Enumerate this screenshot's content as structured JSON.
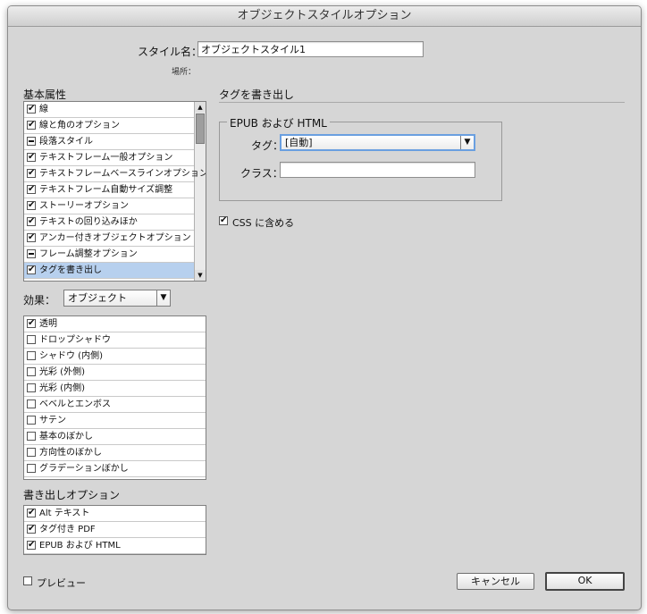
{
  "dialog": {
    "title": "オブジェクトスタイルオプション"
  },
  "header": {
    "style_name_label": "スタイル名：",
    "style_name_value": "オブジェクトスタイル1",
    "location_label": "場所："
  },
  "basic_attributes": {
    "title": "基本属性",
    "items": [
      {
        "label": "線",
        "state": "checked"
      },
      {
        "label": "線と角のオプション",
        "state": "checked"
      },
      {
        "label": "段落スタイル",
        "state": "mixed"
      },
      {
        "label": "テキストフレーム一般オプション",
        "state": "checked"
      },
      {
        "label": "テキストフレームベースラインオプション",
        "state": "checked"
      },
      {
        "label": "テキストフレーム自動サイズ調整",
        "state": "checked"
      },
      {
        "label": "ストーリーオプション",
        "state": "checked"
      },
      {
        "label": "テキストの回り込みほか",
        "state": "checked"
      },
      {
        "label": "アンカー付きオブジェクトオプション",
        "state": "checked"
      },
      {
        "label": "フレーム調整オプション",
        "state": "mixed"
      },
      {
        "label": "タグを書き出し",
        "state": "checked",
        "selected": true
      }
    ]
  },
  "effects": {
    "label": "効果：",
    "target_value": "オブジェクト",
    "items": [
      {
        "label": "透明",
        "state": "checked"
      },
      {
        "label": "ドロップシャドウ",
        "state": "unchecked"
      },
      {
        "label": "シャドウ (内側)",
        "state": "unchecked"
      },
      {
        "label": "光彩 (外側)",
        "state": "unchecked"
      },
      {
        "label": "光彩 (内側)",
        "state": "unchecked"
      },
      {
        "label": "ベベルとエンボス",
        "state": "unchecked"
      },
      {
        "label": "サテン",
        "state": "unchecked"
      },
      {
        "label": "基本のぼかし",
        "state": "unchecked"
      },
      {
        "label": "方向性のぼかし",
        "state": "unchecked"
      },
      {
        "label": "グラデーションぼかし",
        "state": "unchecked"
      }
    ]
  },
  "export_options": {
    "title": "書き出しオプション",
    "items": [
      {
        "label": "Alt テキスト",
        "state": "checked"
      },
      {
        "label": "タグ付き PDF",
        "state": "checked"
      },
      {
        "label": "EPUB および HTML",
        "state": "checked"
      }
    ]
  },
  "export_tagging": {
    "title": "タグを書き出し",
    "group_title": "EPUB および HTML",
    "tag_label": "タグ：",
    "tag_value": "[自動]",
    "class_label": "クラス：",
    "class_value": "",
    "css_label": "CSS に含める",
    "css_checked": "✔"
  },
  "footer": {
    "preview_label": "プレビュー",
    "cancel_label": "キャンセル",
    "ok_label": "OK"
  },
  "icons": {
    "check": "✔",
    "scroll_up": "▲",
    "scroll_down": "▼",
    "dropdown": "▼"
  }
}
